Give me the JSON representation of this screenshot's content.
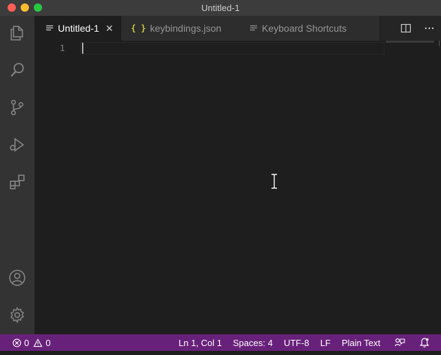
{
  "window": {
    "title": "Untitled-1"
  },
  "tabs": [
    {
      "label": "Untitled-1",
      "active": true,
      "icon": "lines-icon"
    },
    {
      "label": "keybindings.json",
      "active": false,
      "icon": "json-braces-icon"
    },
    {
      "label": "Keyboard Shortcuts",
      "active": false,
      "icon": "lines-icon"
    }
  ],
  "tab_icons": {
    "json": "{ }"
  },
  "editor": {
    "line_numbers": [
      "1"
    ]
  },
  "status": {
    "errors": "0",
    "warnings": "0",
    "position": "Ln 1, Col 1",
    "spaces": "Spaces: 4",
    "encoding": "UTF-8",
    "eol": "LF",
    "language": "Plain Text"
  },
  "colors": {
    "statusbar": "#68217a",
    "titlebar": "#3c3c3c",
    "activitybar": "#333333",
    "editor": "#1e1e1e"
  }
}
